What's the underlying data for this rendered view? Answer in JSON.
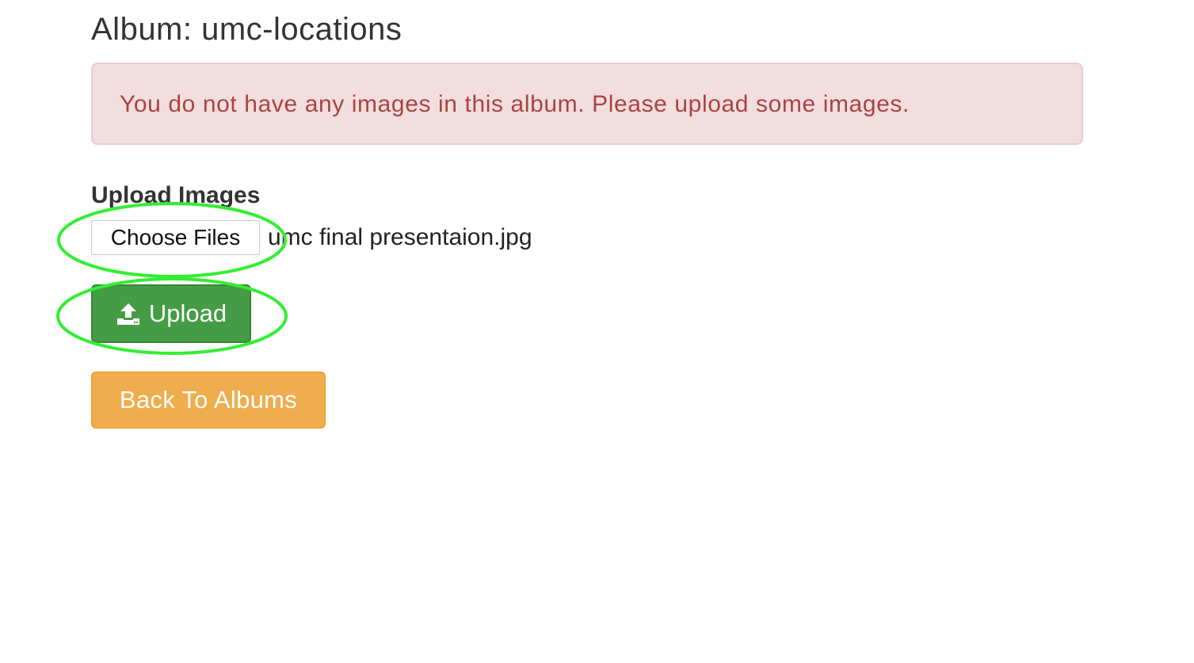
{
  "album": {
    "title": "Album: umc-locations"
  },
  "alert": {
    "message": "You do not have any images in this album. Please upload some images."
  },
  "upload_form": {
    "label": "Upload Images",
    "choose_files_label": "Choose Files",
    "selected_file": "umc final presentaion.jpg",
    "upload_button_label": "Upload",
    "upload_icon": "upload-icon"
  },
  "navigation": {
    "back_button_label": "Back To Albums"
  },
  "colors": {
    "alert_bg": "#f2dede",
    "alert_text": "#a94442",
    "upload_button": "#449d44",
    "back_button": "#f0ad4e",
    "highlight_ring": "#33ee33"
  }
}
